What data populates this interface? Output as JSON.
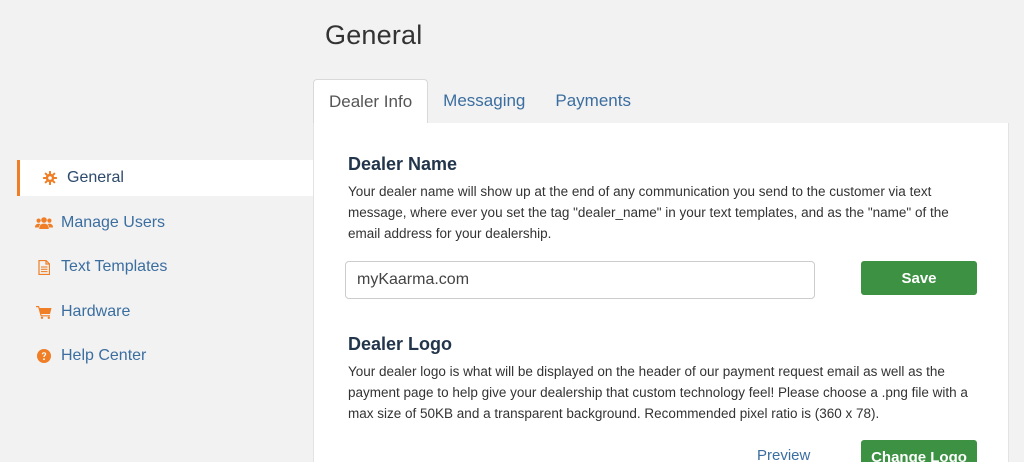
{
  "page": {
    "title": "General"
  },
  "sidebar": {
    "items": [
      {
        "label": "General",
        "icon": "gear-icon",
        "active": true
      },
      {
        "label": "Manage Users",
        "icon": "users-icon"
      },
      {
        "label": "Text Templates",
        "icon": "document-icon"
      },
      {
        "label": "Hardware",
        "icon": "cart-icon"
      },
      {
        "label": "Help Center",
        "icon": "help-icon"
      }
    ]
  },
  "tabs": [
    {
      "label": "Dealer Info",
      "active": true
    },
    {
      "label": "Messaging"
    },
    {
      "label": "Payments"
    }
  ],
  "dealer_name": {
    "title": "Dealer Name",
    "description": "Your dealer name will show up at the end of any communication you send to the customer via text message, where ever you set the tag \"dealer_name\" in your text templates, and as the \"name\" of the email address for your dealership.",
    "input_value": "myKaarma.com",
    "save_label": "Save"
  },
  "dealer_logo": {
    "title": "Dealer Logo",
    "description": "Your dealer logo is what will be displayed on the header of our payment request email as well as the payment page to help give your dealership that custom technology feel! Please choose a .png file with a max size of 50KB and a transparent background. Recommended pixel ratio is (360 x 78).",
    "preview_label": "Preview",
    "change_label": "Change Logo"
  },
  "colors": {
    "accent_orange": "#f07e26",
    "link_blue": "#3b6ea0",
    "button_green": "#3d9143",
    "heading_navy": "#22354b"
  }
}
